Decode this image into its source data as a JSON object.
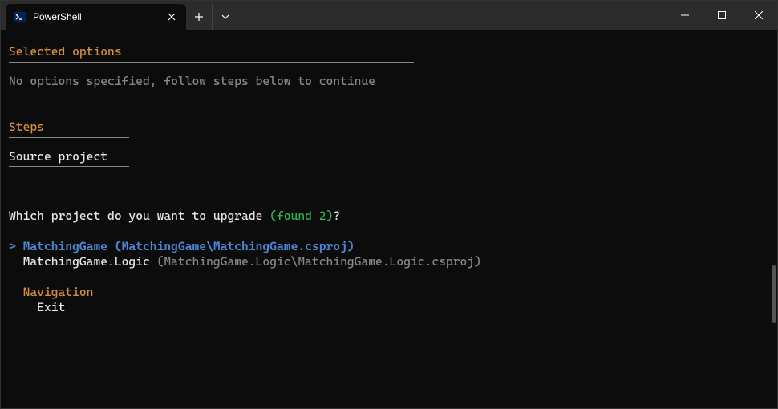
{
  "tab": {
    "title": "PowerShell"
  },
  "sections": {
    "selected_options": {
      "header": "Selected options",
      "message": "No options specified, follow steps below to continue"
    },
    "steps": {
      "header": "Steps",
      "item": "Source project"
    }
  },
  "prompt": {
    "question_prefix": "Which project do you want to upgrade ",
    "found_text": "(found 2)",
    "question_suffix": "?"
  },
  "options": {
    "selected": {
      "marker": "> ",
      "name": "MatchingGame ",
      "path": "(MatchingGame\\MatchingGame.csproj)"
    },
    "unselected": {
      "indent": "  ",
      "name": "MatchingGame.Logic ",
      "path": "(MatchingGame.Logic\\MatchingGame.Logic.csproj)"
    }
  },
  "navigation": {
    "header": "Navigation",
    "item": "Exit"
  }
}
